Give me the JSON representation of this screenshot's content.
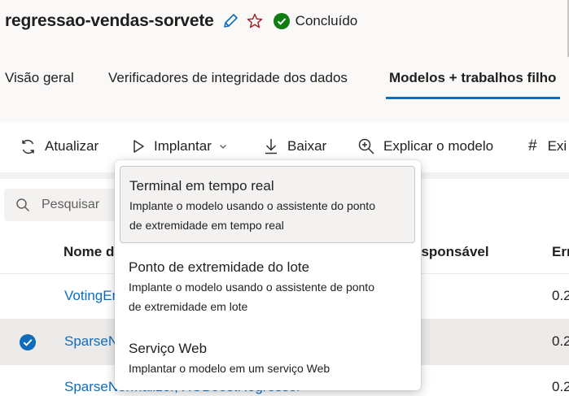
{
  "header": {
    "title": "regressao-vendas-sorvete",
    "status": "Concluído",
    "tabs": [
      "Visão geral",
      "Verificadores de integridade dos dados",
      "Modelos + trabalhos filho"
    ]
  },
  "toolbar": {
    "refresh_label": "Atualizar",
    "deploy_label": "Implantar",
    "download_label": "Baixar",
    "explain_label": "Explicar o modelo",
    "more_label": "Exi"
  },
  "search": {
    "placeholder": "Pesquisar"
  },
  "table": {
    "columns": [
      "Nome d",
      "esponsável",
      "Err"
    ],
    "rows": [
      {
        "name": "VotingEn",
        "error": "0.2",
        "selected": false
      },
      {
        "name": "SparseN",
        "error": "0.2",
        "selected": true
      },
      {
        "name": "SparseNormalizer, XGBoostRegressor",
        "error": "0.2",
        "selected": false
      }
    ]
  },
  "deploy_menu": {
    "items": [
      {
        "title": "Terminal em tempo real",
        "description_lines": [
          "Implante o modelo usando o assistente do ponto",
          "de extremidade em tempo real"
        ]
      },
      {
        "title": "Ponto de extremidade do lote",
        "description_lines": [
          "Implante o modelo usando o assistente de ponto",
          "de extremidade em lote"
        ]
      },
      {
        "title": "Serviço Web",
        "description_lines": [
          "Implantar o modelo em um serviço Web"
        ]
      }
    ]
  },
  "colors": {
    "accent": "#0f6cbd",
    "success": "#107c10",
    "favorite": "#a4262c"
  }
}
